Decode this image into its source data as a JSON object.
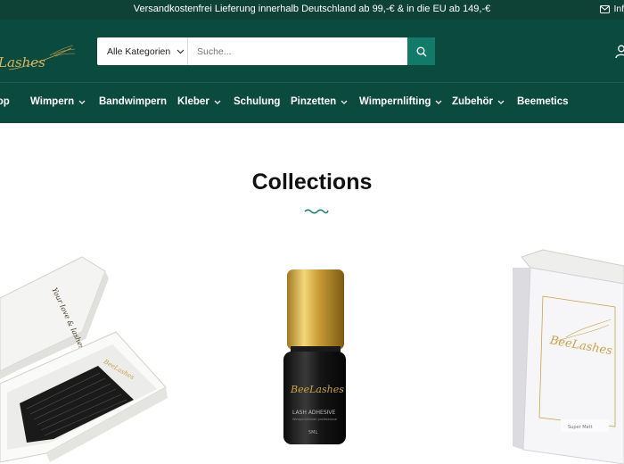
{
  "topbar": {
    "announcement": "Versandkostenfrei Lieferung innerhalb Deutschland ab 99,-€ & in die EU ab 149,-€",
    "info_label": "Info",
    "info_icon": "mail-icon"
  },
  "header": {
    "logo_text": "BeeLashes",
    "search": {
      "category_label": "Alle Kategorien",
      "placeholder": "Suche...",
      "button_icon": "search-icon"
    },
    "account_icon": "user-icon"
  },
  "nav": {
    "items": [
      {
        "label": "Shop",
        "has_dropdown": false
      },
      {
        "label": "Wimpern",
        "has_dropdown": true
      },
      {
        "label": "Bandwimpern",
        "has_dropdown": false
      },
      {
        "label": "Kleber",
        "has_dropdown": true
      },
      {
        "label": "Schulung",
        "has_dropdown": false
      },
      {
        "label": "Pinzetten",
        "has_dropdown": true
      },
      {
        "label": "Wimpernlifting",
        "has_dropdown": true
      },
      {
        "label": "Zubehör",
        "has_dropdown": true
      },
      {
        "label": "Beemetics",
        "has_dropdown": false
      }
    ]
  },
  "main": {
    "title": "Collections",
    "collections": [
      {
        "name": "lash-box",
        "box_script": "Your love & lashes",
        "box_brand": "BeeLashes"
      },
      {
        "name": "lash-adhesive",
        "bottle_brand": "BeeLashes",
        "bottle_label": "LASH ADHESIVE",
        "bottle_sublabel": "Wimpernkleber professional",
        "bottle_size": "5ML"
      },
      {
        "name": "pinzetten-box",
        "box_brand": "BeeLashes",
        "box_caption": "Super Matt"
      }
    ]
  },
  "colors": {
    "topbar_bg": "#0f4237",
    "header_bg": "#0b4a3e",
    "accent": "#127a68",
    "gold": "#c9a24b"
  }
}
